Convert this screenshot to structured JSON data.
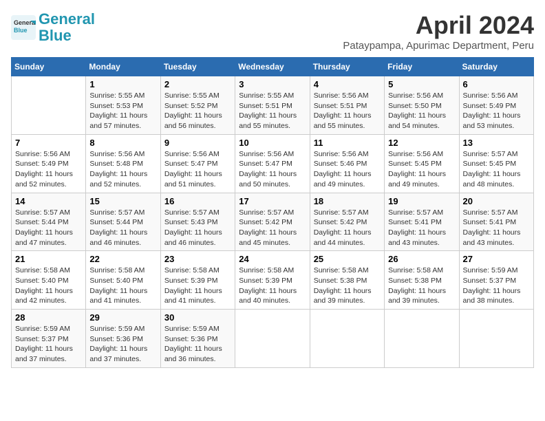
{
  "header": {
    "logo_line1": "General",
    "logo_line2": "Blue",
    "month": "April 2024",
    "location": "Pataypampa, Apurimac Department, Peru"
  },
  "weekdays": [
    "Sunday",
    "Monday",
    "Tuesday",
    "Wednesday",
    "Thursday",
    "Friday",
    "Saturday"
  ],
  "weeks": [
    [
      {
        "day": "",
        "info": ""
      },
      {
        "day": "1",
        "info": "Sunrise: 5:55 AM\nSunset: 5:53 PM\nDaylight: 11 hours\nand 57 minutes."
      },
      {
        "day": "2",
        "info": "Sunrise: 5:55 AM\nSunset: 5:52 PM\nDaylight: 11 hours\nand 56 minutes."
      },
      {
        "day": "3",
        "info": "Sunrise: 5:55 AM\nSunset: 5:51 PM\nDaylight: 11 hours\nand 55 minutes."
      },
      {
        "day": "4",
        "info": "Sunrise: 5:56 AM\nSunset: 5:51 PM\nDaylight: 11 hours\nand 55 minutes."
      },
      {
        "day": "5",
        "info": "Sunrise: 5:56 AM\nSunset: 5:50 PM\nDaylight: 11 hours\nand 54 minutes."
      },
      {
        "day": "6",
        "info": "Sunrise: 5:56 AM\nSunset: 5:49 PM\nDaylight: 11 hours\nand 53 minutes."
      }
    ],
    [
      {
        "day": "7",
        "info": "Sunrise: 5:56 AM\nSunset: 5:49 PM\nDaylight: 11 hours\nand 52 minutes."
      },
      {
        "day": "8",
        "info": "Sunrise: 5:56 AM\nSunset: 5:48 PM\nDaylight: 11 hours\nand 52 minutes."
      },
      {
        "day": "9",
        "info": "Sunrise: 5:56 AM\nSunset: 5:47 PM\nDaylight: 11 hours\nand 51 minutes."
      },
      {
        "day": "10",
        "info": "Sunrise: 5:56 AM\nSunset: 5:47 PM\nDaylight: 11 hours\nand 50 minutes."
      },
      {
        "day": "11",
        "info": "Sunrise: 5:56 AM\nSunset: 5:46 PM\nDaylight: 11 hours\nand 49 minutes."
      },
      {
        "day": "12",
        "info": "Sunrise: 5:56 AM\nSunset: 5:45 PM\nDaylight: 11 hours\nand 49 minutes."
      },
      {
        "day": "13",
        "info": "Sunrise: 5:57 AM\nSunset: 5:45 PM\nDaylight: 11 hours\nand 48 minutes."
      }
    ],
    [
      {
        "day": "14",
        "info": "Sunrise: 5:57 AM\nSunset: 5:44 PM\nDaylight: 11 hours\nand 47 minutes."
      },
      {
        "day": "15",
        "info": "Sunrise: 5:57 AM\nSunset: 5:44 PM\nDaylight: 11 hours\nand 46 minutes."
      },
      {
        "day": "16",
        "info": "Sunrise: 5:57 AM\nSunset: 5:43 PM\nDaylight: 11 hours\nand 46 minutes."
      },
      {
        "day": "17",
        "info": "Sunrise: 5:57 AM\nSunset: 5:42 PM\nDaylight: 11 hours\nand 45 minutes."
      },
      {
        "day": "18",
        "info": "Sunrise: 5:57 AM\nSunset: 5:42 PM\nDaylight: 11 hours\nand 44 minutes."
      },
      {
        "day": "19",
        "info": "Sunrise: 5:57 AM\nSunset: 5:41 PM\nDaylight: 11 hours\nand 43 minutes."
      },
      {
        "day": "20",
        "info": "Sunrise: 5:57 AM\nSunset: 5:41 PM\nDaylight: 11 hours\nand 43 minutes."
      }
    ],
    [
      {
        "day": "21",
        "info": "Sunrise: 5:58 AM\nSunset: 5:40 PM\nDaylight: 11 hours\nand 42 minutes."
      },
      {
        "day": "22",
        "info": "Sunrise: 5:58 AM\nSunset: 5:40 PM\nDaylight: 11 hours\nand 41 minutes."
      },
      {
        "day": "23",
        "info": "Sunrise: 5:58 AM\nSunset: 5:39 PM\nDaylight: 11 hours\nand 41 minutes."
      },
      {
        "day": "24",
        "info": "Sunrise: 5:58 AM\nSunset: 5:39 PM\nDaylight: 11 hours\nand 40 minutes."
      },
      {
        "day": "25",
        "info": "Sunrise: 5:58 AM\nSunset: 5:38 PM\nDaylight: 11 hours\nand 39 minutes."
      },
      {
        "day": "26",
        "info": "Sunrise: 5:58 AM\nSunset: 5:38 PM\nDaylight: 11 hours\nand 39 minutes."
      },
      {
        "day": "27",
        "info": "Sunrise: 5:59 AM\nSunset: 5:37 PM\nDaylight: 11 hours\nand 38 minutes."
      }
    ],
    [
      {
        "day": "28",
        "info": "Sunrise: 5:59 AM\nSunset: 5:37 PM\nDaylight: 11 hours\nand 37 minutes."
      },
      {
        "day": "29",
        "info": "Sunrise: 5:59 AM\nSunset: 5:36 PM\nDaylight: 11 hours\nand 37 minutes."
      },
      {
        "day": "30",
        "info": "Sunrise: 5:59 AM\nSunset: 5:36 PM\nDaylight: 11 hours\nand 36 minutes."
      },
      {
        "day": "",
        "info": ""
      },
      {
        "day": "",
        "info": ""
      },
      {
        "day": "",
        "info": ""
      },
      {
        "day": "",
        "info": ""
      }
    ]
  ]
}
